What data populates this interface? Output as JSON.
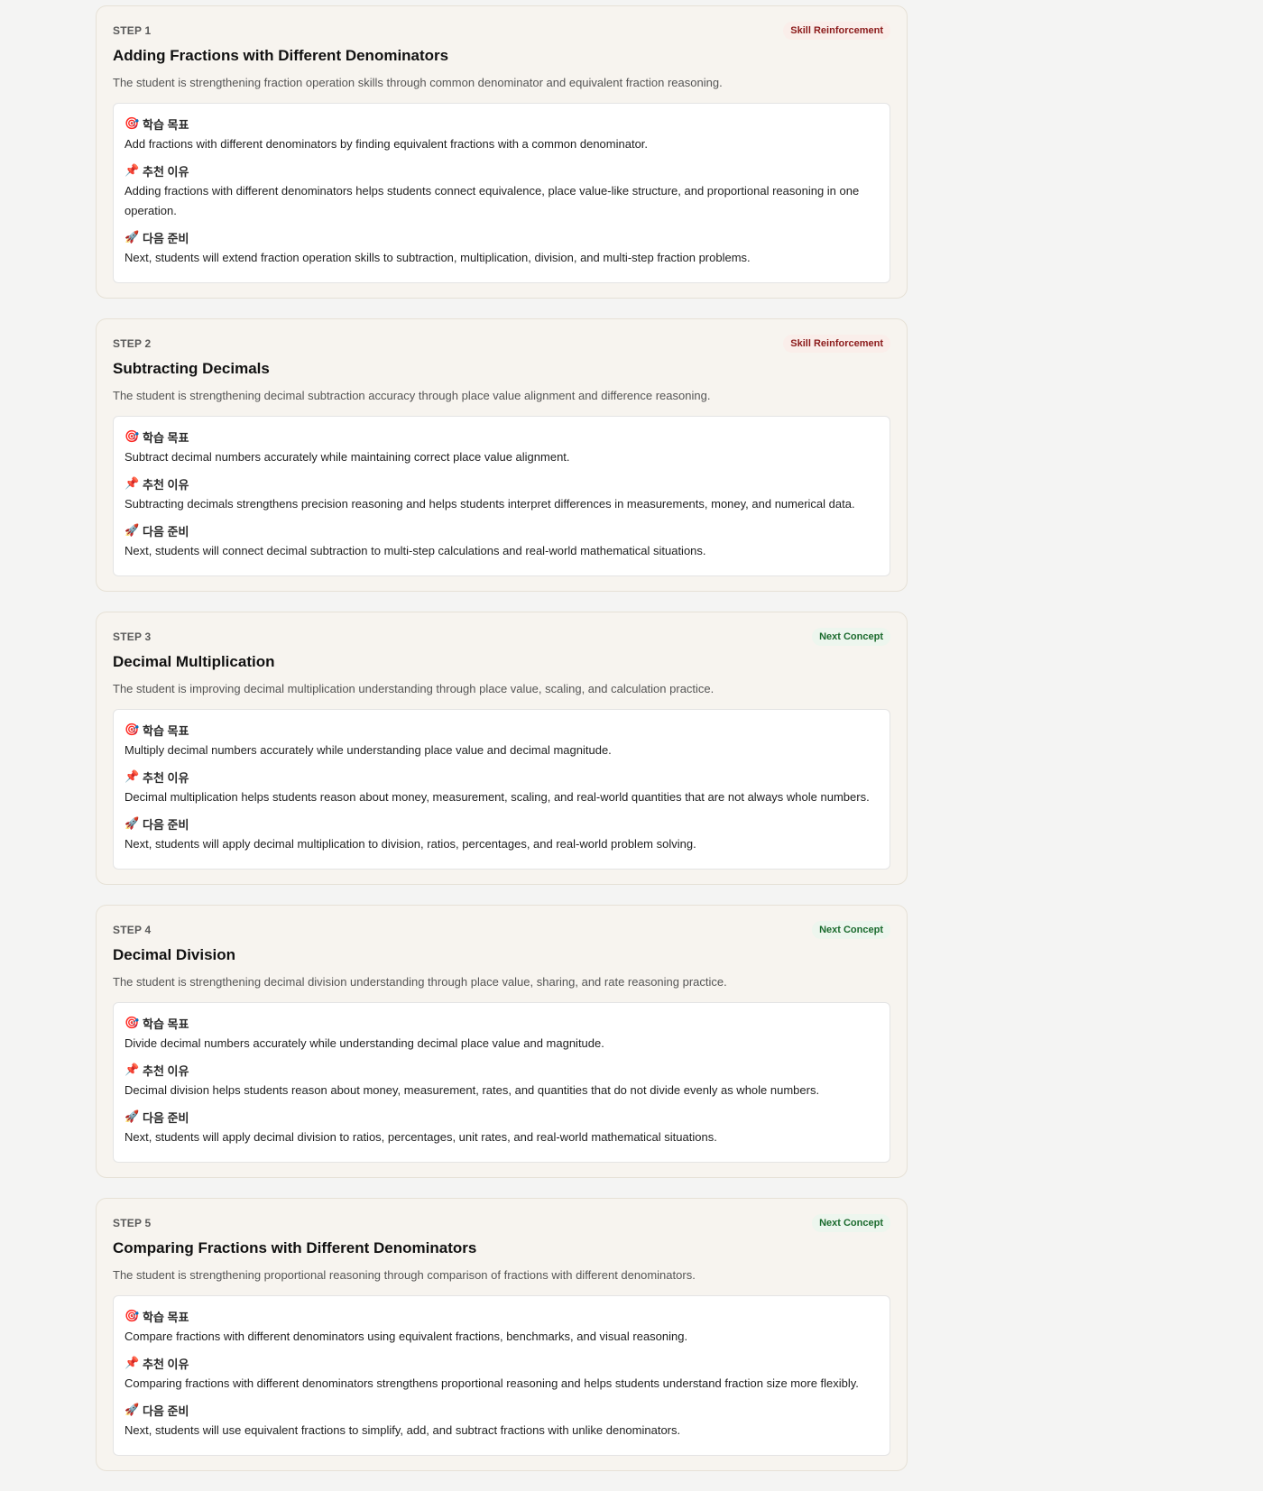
{
  "labels": {
    "goal": "학습 목표",
    "reason": "추천 이유",
    "next": "다음 준비"
  },
  "icons": {
    "goal": "target-icon",
    "reason": "pin-icon",
    "next": "rocket-icon"
  },
  "colors": {
    "reinforce": "#8b1a1a",
    "next_concept": "#1b6b2e",
    "card_bg": "#f7f4ef"
  },
  "steps": [
    {
      "step": "STEP 1",
      "badge": "Skill Reinforcement",
      "title": "Adding Fractions with Different Denominators",
      "summary": "The student is strengthening fraction operation skills through common denominator and equivalent fraction reasoning.",
      "goal": "Add fractions with different denominators by finding equivalent fractions with a common denominator.",
      "reason": "Adding fractions with different denominators helps students connect equivalence, place value-like structure, and proportional reasoning in one operation.",
      "next": "Next, students will extend fraction operation skills to subtraction, multiplication, division, and multi-step fraction problems."
    },
    {
      "step": "STEP 2",
      "badge": "Skill Reinforcement",
      "title": "Subtracting Decimals",
      "summary": "The student is strengthening decimal subtraction accuracy through place value alignment and difference reasoning.",
      "goal": "Subtract decimal numbers accurately while maintaining correct place value alignment.",
      "reason": "Subtracting decimals strengthens precision reasoning and helps students interpret differences in measurements, money, and numerical data.",
      "next": "Next, students will connect decimal subtraction to multi-step calculations and real-world mathematical situations."
    },
    {
      "step": "STEP 3",
      "badge": "Next Concept",
      "title": "Decimal Multiplication",
      "summary": "The student is improving decimal multiplication understanding through place value, scaling, and calculation practice.",
      "goal": "Multiply decimal numbers accurately while understanding place value and decimal magnitude.",
      "reason": "Decimal multiplication helps students reason about money, measurement, scaling, and real-world quantities that are not always whole numbers.",
      "next": "Next, students will apply decimal multiplication to division, ratios, percentages, and real-world problem solving."
    },
    {
      "step": "STEP 4",
      "badge": "Next Concept",
      "title": "Decimal Division",
      "summary": "The student is strengthening decimal division understanding through place value, sharing, and rate reasoning practice.",
      "goal": "Divide decimal numbers accurately while understanding decimal place value and magnitude.",
      "reason": "Decimal division helps students reason about money, measurement, rates, and quantities that do not divide evenly as whole numbers.",
      "next": "Next, students will apply decimal division to ratios, percentages, unit rates, and real-world mathematical situations."
    },
    {
      "step": "STEP 5",
      "badge": "Next Concept",
      "title": "Comparing Fractions with Different Denominators",
      "summary": "The student is strengthening proportional reasoning through comparison of fractions with different denominators.",
      "goal": "Compare fractions with different denominators using equivalent fractions, benchmarks, and visual reasoning.",
      "reason": "Comparing fractions with different denominators strengthens proportional reasoning and helps students understand fraction size more flexibly.",
      "next": "Next, students will use equivalent fractions to simplify, add, and subtract fractions with unlike denominators."
    }
  ]
}
